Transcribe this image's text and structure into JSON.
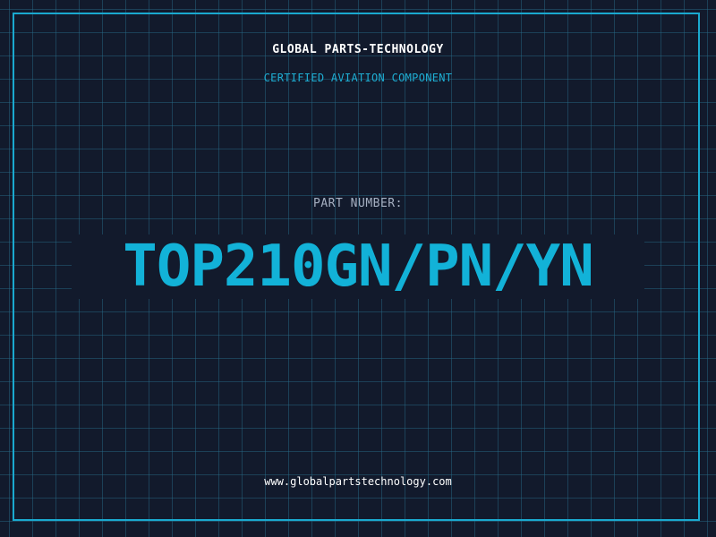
{
  "header": {
    "company_name": "GLOBAL PARTS-TECHNOLOGY",
    "tagline": "CERTIFIED AVIATION COMPONENT"
  },
  "part": {
    "label": "PART NUMBER:",
    "number": "TOP210GN/PN/YN"
  },
  "footer": {
    "website": "www.globalpartstechnology.com"
  },
  "colors": {
    "background": "#121a2c",
    "grid": "#286e8c",
    "accent": "#1aa9cf",
    "part_number": "#12b2d8"
  }
}
